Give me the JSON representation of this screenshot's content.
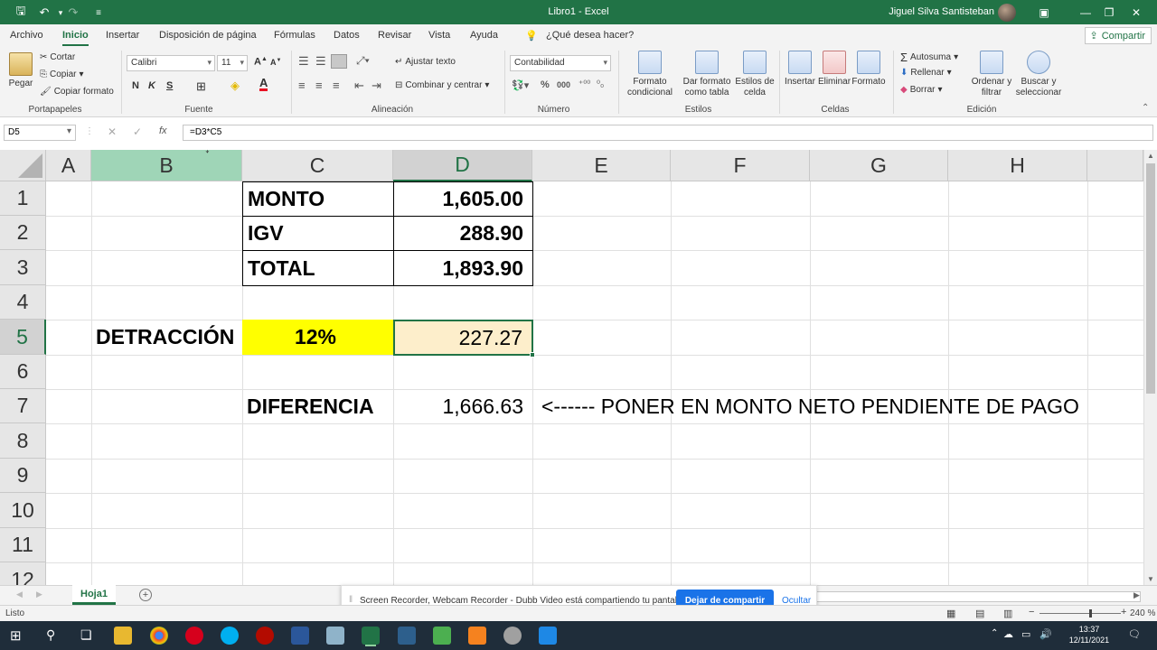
{
  "titlebar": {
    "title": "Libro1 - Excel",
    "user": "Jiguel Silva Santisteban",
    "minimize": "—",
    "restore": "❐",
    "close": "✕",
    "ribbon_display": "▣"
  },
  "menu": {
    "tabs": [
      "Archivo",
      "Inicio",
      "Insertar",
      "Disposición de página",
      "Fórmulas",
      "Datos",
      "Revisar",
      "Vista",
      "Ayuda"
    ],
    "active_tab": "Inicio",
    "search_hint": "¿Qué desea hacer?",
    "share": "Compartir"
  },
  "ribbon": {
    "clipboard": {
      "paste": "Pegar",
      "cut": "Cortar",
      "copy": "Copiar",
      "format_painter": "Copiar formato",
      "label": "Portapapeles"
    },
    "font": {
      "name": "Calibri",
      "size": "11",
      "bold": "N",
      "italic": "K",
      "underline": "S",
      "label": "Fuente"
    },
    "alignment": {
      "wrap": "Ajustar texto",
      "merge": "Combinar y centrar",
      "label": "Alineación"
    },
    "number": {
      "format": "Contabilidad",
      "percent": "%",
      "thousands": "000",
      "label": "Número"
    },
    "styles": {
      "conditional": "Formato condicional",
      "table": "Dar formato como tabla",
      "cell_styles": "Estilos de celda",
      "label": "Estilos"
    },
    "cells": {
      "insert": "Insertar",
      "delete": "Eliminar",
      "format": "Formato",
      "label": "Celdas"
    },
    "editing": {
      "autosum": "Autosuma",
      "fill": "Rellenar",
      "clear": "Borrar",
      "sort": "Ordenar y filtrar",
      "find": "Buscar y seleccionar",
      "label": "Edición"
    }
  },
  "formula_bar": {
    "name_box": "D5",
    "formula": "=D3*C5",
    "fx": "fx"
  },
  "sheet": {
    "columns": [
      "A",
      "B",
      "C",
      "D",
      "E",
      "F",
      "G",
      "H"
    ],
    "rows": [
      "1",
      "2",
      "3",
      "4",
      "5",
      "6",
      "7",
      "8",
      "9",
      "10",
      "11",
      "12"
    ],
    "cells": {
      "C1": "MONTO",
      "D1": "1,605.00",
      "C2": "IGV",
      "D2": "288.90",
      "C3": "TOTAL",
      "D3": "1,893.90",
      "B5": "DETRACCIÓN",
      "C5": "12%",
      "D5": "227.27",
      "C7": "DIFERENCIA",
      "D7": "1,666.63",
      "E7": "<------ PONER EN MONTO NETO PENDIENTE DE PAGO"
    },
    "colors": {
      "yellow_fill": "#ffff00",
      "active_fill": "#fdeecb",
      "accent": "#217346"
    }
  },
  "sheet_tabs": {
    "tab": "Hoja1",
    "add": "+"
  },
  "notification": {
    "message": "Screen Recorder, Webcam Recorder - Dubb Video está compartiendo tu pantalla.",
    "stop": "Dejar de compartir",
    "hide": "Ocultar"
  },
  "status": {
    "ready": "Listo",
    "zoom": "240 %"
  },
  "taskbar": {
    "time": "13:37",
    "date": "12/11/2021"
  }
}
